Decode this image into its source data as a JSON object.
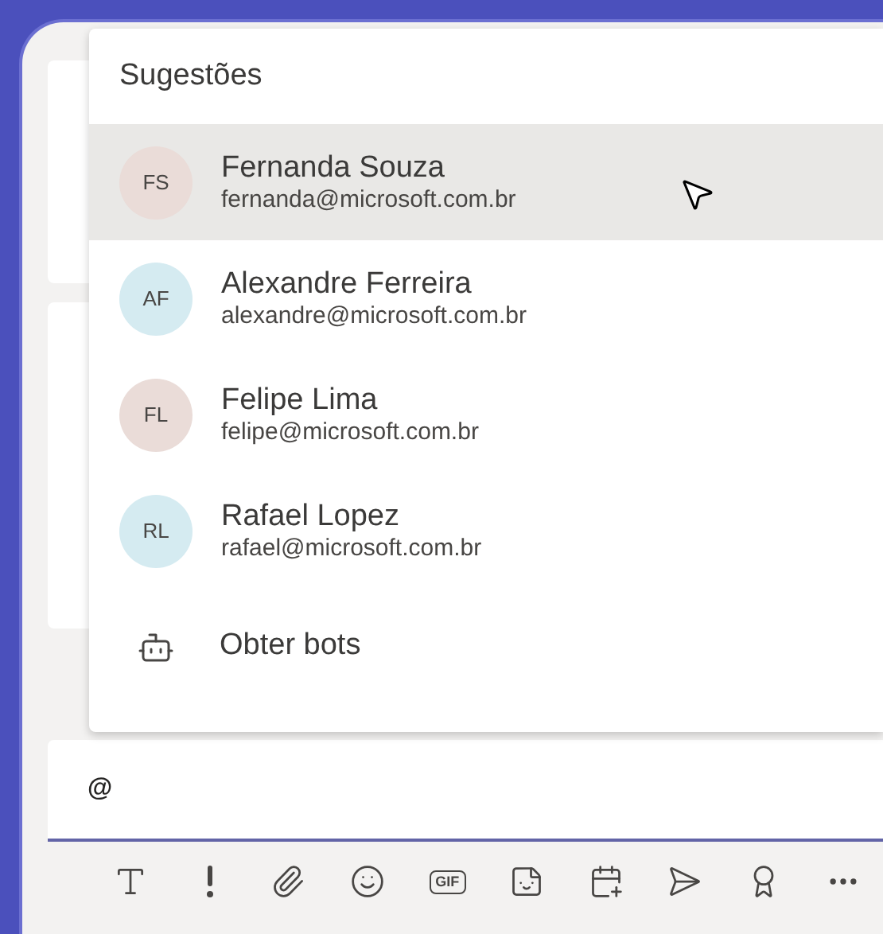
{
  "suggestions": {
    "title": "Sugestões",
    "people": [
      {
        "initials": "FS",
        "name": "Fernanda Souza",
        "email": "fernanda@microsoft.com.br",
        "color": "#eadcd8",
        "selected": true
      },
      {
        "initials": "AF",
        "name": "Alexandre Ferreira",
        "email": "alexandre@microsoft.com.br",
        "color": "#d5ebf1",
        "selected": false
      },
      {
        "initials": "FL",
        "name": "Felipe Lima",
        "email": "felipe@microsoft.com.br",
        "color": "#eadcd8",
        "selected": false
      },
      {
        "initials": "RL",
        "name": "Rafael Lopez",
        "email": "rafael@microsoft.com.br",
        "color": "#d5ebf1",
        "selected": false
      }
    ],
    "action": "Obter bots"
  },
  "composer": {
    "value": "@"
  },
  "toolbar": [
    {
      "kind": "format"
    },
    {
      "kind": "important"
    },
    {
      "kind": "attach"
    },
    {
      "kind": "emoji"
    },
    {
      "kind": "gif",
      "label": "GIF"
    },
    {
      "kind": "sticker"
    },
    {
      "kind": "schedule"
    },
    {
      "kind": "send"
    },
    {
      "kind": "praise"
    },
    {
      "kind": "more"
    }
  ]
}
